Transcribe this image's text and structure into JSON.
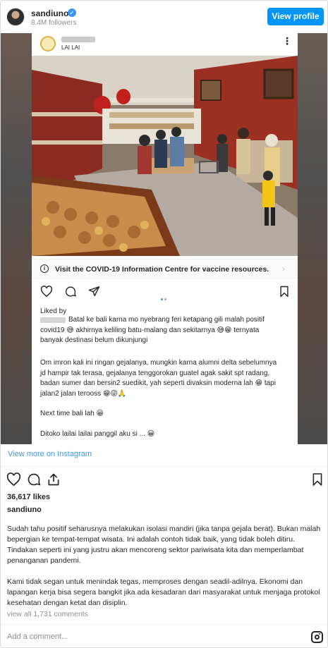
{
  "header": {
    "username": "sandiuno",
    "followers": "8.4M followers",
    "view_profile_label": "View profile"
  },
  "media": {
    "location": "LAI LAI",
    "covid_banner": "Visit the COVID-19 Information Centre for vaccine resources.",
    "liked_by": "Liked by",
    "caption_lines": [
      "Batal ke bali karna mo nyebrang feri ketapang gili malah positif\ncovid19 😅 akhirnya keliling batu-malang dan sekitarnya 😅😁 ternyata\nbanyak destinasi belum dikunjungi",
      "Om imron kali ini ringan gejalanya, mungkin karna alumni delta sebelumnya\njd hampir tak terasa, gejalanya tenggorokan guatel agak sakit spt radang,\nbadan sumer dan bersin2 suedikit, yah seperti divaksin moderna lah 😁 tapi\njalan2 jalan terooss 😁😜🙏",
      "Next time bali lah 😀",
      "Ditoko lailai lailai panggil aku si ... 😀"
    ]
  },
  "view_more_label": "View more on Instagram",
  "likes": "36,617 likes",
  "owner": "sandiuno",
  "caption": [
    "Sudah tahu positif seharusnya melakukan isolasi mandiri (jika tanpa gejala berat). Bukan malah bepergian ke tempat-tempat wisata. Ini adalah contoh tidak baik, yang tidak boleh ditiru. Tindakan seperti ini yang justru akan mencoreng sektor pariwisata kita dan memperlambat penanganan pandemi.",
    "Kami tidak segan untuk menindak tegas, memproses dengan seadil-adilnya. Ekonomi dan lapangan kerja bisa segera bangkit jika ada kesadaran dari masyarakat untuk menjaga protokol kesehatan dengan ketat dan disiplin."
  ],
  "comments_label": "view all 1,731 comments",
  "comment_placeholder": "Add a comment...",
  "colors": {
    "accent": "#0095f6",
    "link": "#3897f0",
    "text": "#262626",
    "muted": "#8e8e8e"
  }
}
